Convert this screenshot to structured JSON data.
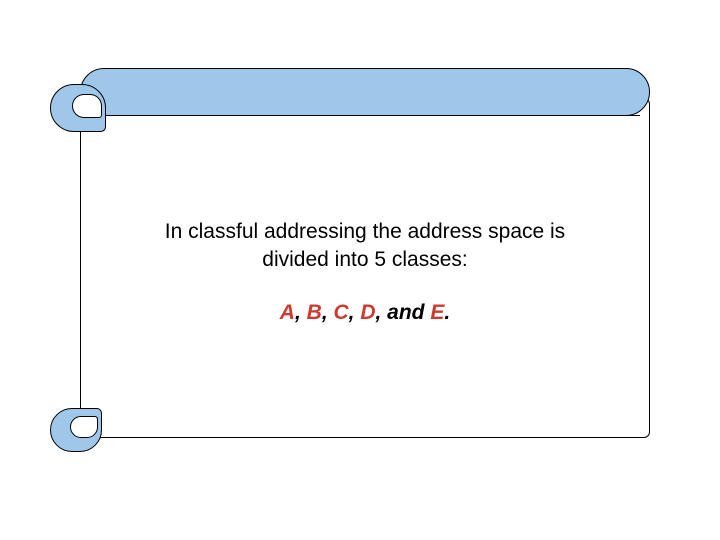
{
  "slide": {
    "body_line1": "In classful addressing the address space is",
    "body_line2": "divided into  5 classes:",
    "classes": {
      "a": "A",
      "b": "B",
      "c": "C",
      "d": "D",
      "and": " and ",
      "e": "E",
      "comma": ", ",
      "period": "."
    }
  },
  "colors": {
    "scroll_fill": "#9ec7ea",
    "accent_red": "#cf3a2e"
  }
}
